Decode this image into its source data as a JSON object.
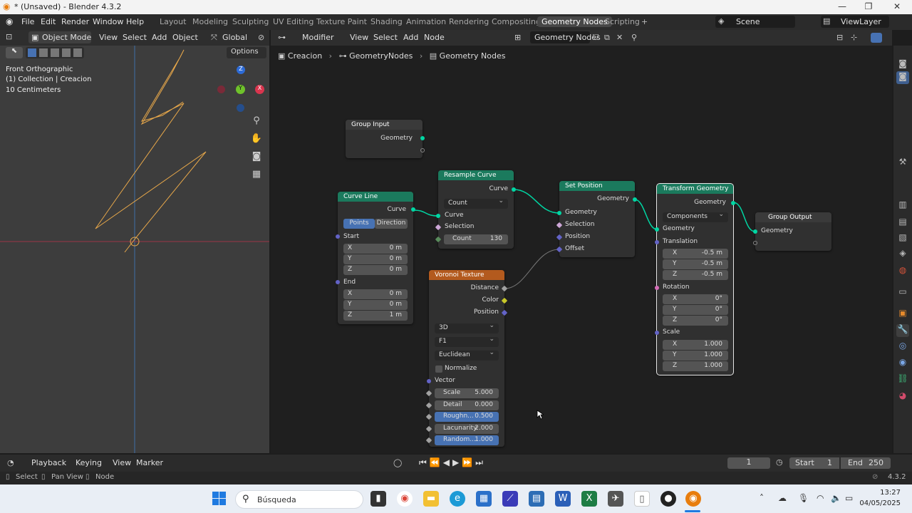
{
  "window": {
    "title": "* (Unsaved) - Blender 4.3.2"
  },
  "menu": [
    "File",
    "Edit",
    "Render",
    "Window",
    "Help"
  ],
  "workspaces": [
    "Layout",
    "Modeling",
    "Sculpting",
    "UV Editing",
    "Texture Paint",
    "Shading",
    "Animation",
    "Rendering",
    "Compositing",
    "Geometry Nodes",
    "Scripting"
  ],
  "active_workspace": "Geometry Nodes",
  "scene": {
    "label": "Scene",
    "view_layer": "ViewLayer"
  },
  "viewport": {
    "mode": "Object Mode",
    "menus": [
      "View",
      "Select",
      "Add",
      "Object"
    ],
    "orientation": "Global",
    "options": "Options",
    "info": [
      "Front Orthographic",
      "(1) Collection | Creacion",
      "10 Centimeters"
    ],
    "gizmo": {
      "z": "Z",
      "y": "Y",
      "x": "X"
    }
  },
  "node_editor": {
    "type": "Modifier",
    "menus": [
      "View",
      "Select",
      "Add",
      "Node"
    ],
    "tree_name": "Geometry Nodes",
    "breadcrumb": [
      "Creacion",
      "GeometryNodes",
      "Geometry Nodes"
    ]
  },
  "nodes": {
    "group_input": {
      "title": "Group Input",
      "out": "Geometry"
    },
    "curve_line": {
      "title": "Curve Line",
      "out": "Curve",
      "tab_active": "Points",
      "tab_other": "Direction",
      "start": "Start",
      "end": "End",
      "start_xyz": [
        [
          "X",
          "0 m"
        ],
        [
          "Y",
          "0 m"
        ],
        [
          "Z",
          "0 m"
        ]
      ],
      "end_xyz": [
        [
          "X",
          "0 m"
        ],
        [
          "Y",
          "0 m"
        ],
        [
          "Z",
          "1 m"
        ]
      ]
    },
    "resample": {
      "title": "Resample Curve",
      "out": "Curve",
      "mode": "Count",
      "in_curve": "Curve",
      "selection": "Selection",
      "count_label": "Count",
      "count_value": "130"
    },
    "set_position": {
      "title": "Set Position",
      "out": "Geometry",
      "in_geometry": "Geometry",
      "selection": "Selection",
      "position": "Position",
      "offset": "Offset"
    },
    "voronoi": {
      "title": "Voronoi Texture",
      "outs": [
        "Distance",
        "Color",
        "Position"
      ],
      "dims": "3D",
      "feature": "F1",
      "metric": "Euclidean",
      "normalize": "Normalize",
      "vector": "Vector",
      "fields": [
        [
          "Scale",
          "5.000"
        ],
        [
          "Detail",
          "0.000"
        ],
        [
          "Roughn...",
          "0.500"
        ],
        [
          "Lacunarity",
          "2.000"
        ],
        [
          "Random...",
          "1.000"
        ]
      ]
    },
    "transform": {
      "title": "Transform Geometry",
      "out": "Geometry",
      "mode": "Components",
      "in_geometry": "Geometry",
      "translation": "Translation",
      "rotation": "Rotation",
      "scale": "Scale",
      "translation_xyz": [
        [
          "X",
          "-0.5 m"
        ],
        [
          "Y",
          "-0.5 m"
        ],
        [
          "Z",
          "-0.5 m"
        ]
      ],
      "rotation_xyz": [
        [
          "X",
          "0°"
        ],
        [
          "Y",
          "0°"
        ],
        [
          "Z",
          "0°"
        ]
      ],
      "scale_xyz": [
        [
          "X",
          "1.000"
        ],
        [
          "Y",
          "1.000"
        ],
        [
          "Z",
          "1.000"
        ]
      ]
    },
    "group_output": {
      "title": "Group Output",
      "in": "Geometry"
    }
  },
  "timeline": {
    "menus": [
      "Playback",
      "Keying",
      "View",
      "Marker"
    ],
    "frame": "1",
    "start_label": "Start",
    "start": "1",
    "end_label": "End",
    "end": "250"
  },
  "statusbar": {
    "items": [
      "Select",
      "Pan View",
      "Node"
    ],
    "version": "4.3.2"
  },
  "taskbar": {
    "search": "Búsqueda",
    "time": "13:27",
    "date": "04/05/2025"
  },
  "colors": {
    "geometry_socket": "#00d6a3",
    "vector_socket": "#6363c7",
    "color_socket": "#c7c729",
    "geometry_node_header": "#1b7a5d",
    "texture_node_header": "#b35a1e",
    "curve_wire": "#e8a84a"
  }
}
